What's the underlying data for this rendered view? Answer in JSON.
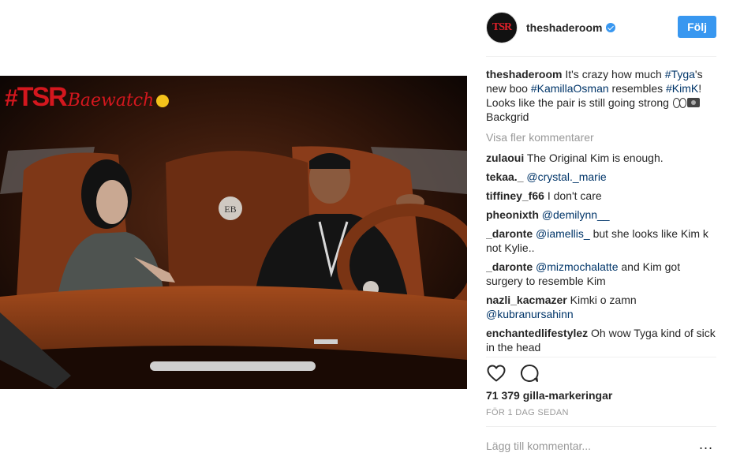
{
  "post": {
    "image": {
      "alt": ""
    },
    "watermark": {
      "hash": "#",
      "brand": "TSR",
      "script": "Baewatch"
    }
  },
  "header": {
    "avatar_text": "TSR",
    "username": "theshaderoom",
    "verified": true,
    "follow_label": "Följ"
  },
  "caption": {
    "username": "theshaderoom",
    "parts": [
      "It's crazy how much ",
      "#Tyga",
      "'s new boo ",
      "#KamillaOsman",
      " resembles ",
      "#KimK",
      "! Looks like the pair is still going strong ",
      " Backgrid"
    ]
  },
  "view_more": "Visa fler kommentarer",
  "comments": [
    {
      "user": "zulaoui",
      "text": "The Original Kim is enough.",
      "mention": ""
    },
    {
      "user": "tekaa._",
      "text": "",
      "mention": "@crystal._marie"
    },
    {
      "user": "tiffiney_f66",
      "text": "I don't care",
      "mention": ""
    },
    {
      "user": "pheonixth",
      "text": "",
      "mention": "@demilynn__"
    },
    {
      "user": "_daronte",
      "mention": "@iamellis_",
      "text": " but she looks like Kim k not Kylie.."
    },
    {
      "user": "_daronte",
      "mention": "@mizmochalatte",
      "text": " and Kim got surgery to resemble Kim"
    },
    {
      "user": "nazli_kacmazer",
      "text": "Kimki o zamn ",
      "mention": "@kubranursahinn"
    },
    {
      "user": "enchantedlifestylez",
      "text": "Oh wow Tyga kind of sick in the head",
      "mention": ""
    }
  ],
  "likes": "71 379 gilla-markeringar",
  "timestamp": "FÖR 1 DAG SEDAN",
  "add_comment": {
    "placeholder": "Lägg till kommentar...",
    "more": "..."
  },
  "icons": {
    "like": "heart-icon",
    "comment": "comment-bubble-icon",
    "verified": "verified-badge-icon"
  },
  "colors": {
    "accent": "#3897f0",
    "hashtag": "#003569",
    "muted": "#999999",
    "brand_red": "#d4171e"
  }
}
